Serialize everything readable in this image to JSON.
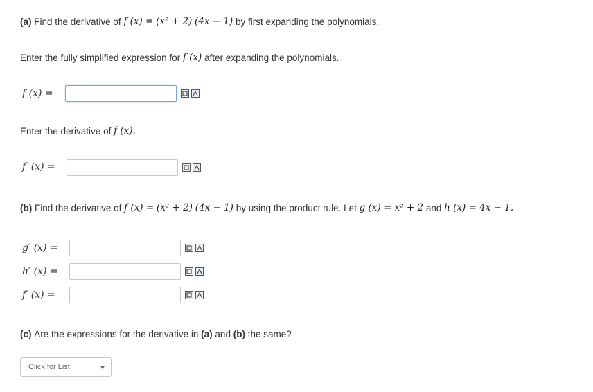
{
  "part_a": {
    "tag": "(a)",
    "text_1": "Find the derivative of",
    "f_of_x": "f (x) =",
    "factor_1": "(x² + 2)",
    "factor_2": "(4x − 1)",
    "text_2": "by first expanding the polynomials."
  },
  "instr_expand": {
    "text_1": "Enter the fully simplified expression for",
    "f_of_x": "f (x)",
    "text_2": "after expanding the polynomials."
  },
  "field_f": {
    "label": "f (x) =",
    "value": ""
  },
  "instr_derivative": {
    "text_1": "Enter the derivative of",
    "f_of_x": "f (x)."
  },
  "field_fprime_a": {
    "label": "f′ (x) =",
    "value": ""
  },
  "part_b": {
    "tag": "(b)",
    "text_1": "Find the derivative of",
    "f_of_x": "f (x) =",
    "factor_1": "(x² + 2)",
    "factor_2": "(4x − 1)",
    "text_2": "by using the product rule. Let",
    "g_def": "g (x) = x² + 2",
    "text_3": "and",
    "h_def": "h (x) = 4x − 1."
  },
  "field_gprime": {
    "label": "g′ (x) =",
    "value": ""
  },
  "field_hprime": {
    "label": "h′ (x) =",
    "value": ""
  },
  "field_fprime_b": {
    "label": "f′ (x) =",
    "value": ""
  },
  "part_c": {
    "tag": "(c)",
    "text_1": "Are the expressions for the derivative in",
    "ref_a": "(a)",
    "text_2": "and",
    "ref_b": "(b)",
    "text_3": "the same?"
  },
  "dropdown": {
    "placeholder": "Click for List"
  },
  "icons": {
    "preview": "preview-icon",
    "help": "help-icon"
  }
}
